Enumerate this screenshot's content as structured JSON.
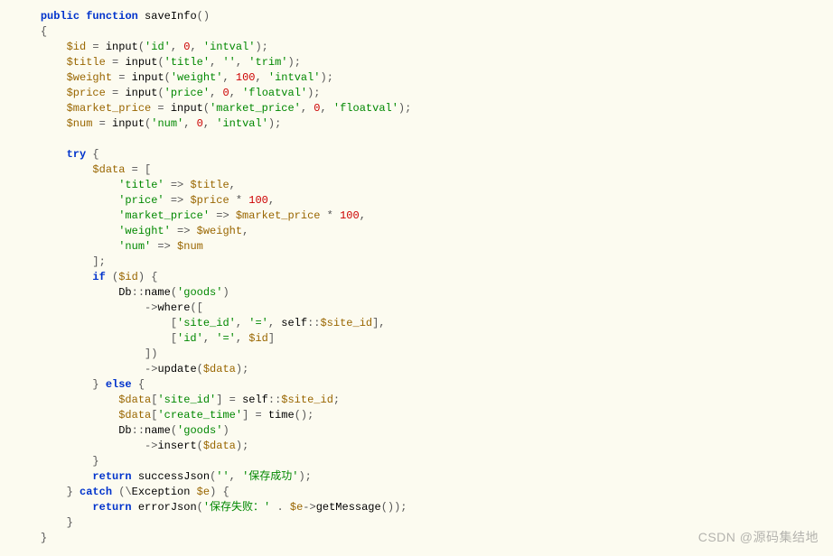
{
  "code": {
    "l1": {
      "kw1": "public",
      "kw2": "function",
      "name": "saveInfo",
      "paren": "()"
    },
    "l2": {
      "brace": "{"
    },
    "l3": {
      "v": "$id",
      "eq": " = ",
      "fn": "input",
      "args_open": "(",
      "s1": "'id'",
      "c1": ", ",
      "n1": "0",
      "c2": ", ",
      "s2": "'intval'",
      "args_close": ");"
    },
    "l4": {
      "v": "$title",
      "eq": " = ",
      "fn": "input",
      "args_open": "(",
      "s1": "'title'",
      "c1": ", ",
      "s2": "''",
      "c2": ", ",
      "s3": "'trim'",
      "args_close": ");"
    },
    "l5": {
      "v": "$weight",
      "eq": " = ",
      "fn": "input",
      "args_open": "(",
      "s1": "'weight'",
      "c1": ", ",
      "n1": "100",
      "c2": ", ",
      "s2": "'intval'",
      "args_close": ");"
    },
    "l6": {
      "v": "$price",
      "eq": " = ",
      "fn": "input",
      "args_open": "(",
      "s1": "'price'",
      "c1": ", ",
      "n1": "0",
      "c2": ", ",
      "s2": "'floatval'",
      "args_close": ");"
    },
    "l7": {
      "v": "$market_price",
      "eq": " = ",
      "fn": "input",
      "args_open": "(",
      "s1": "'market_price'",
      "c1": ", ",
      "n1": "0",
      "c2": ", ",
      "s2": "'floatval'",
      "args_close": ");"
    },
    "l8": {
      "v": "$num",
      "eq": " = ",
      "fn": "input",
      "args_open": "(",
      "s1": "'num'",
      "c1": ", ",
      "n1": "0",
      "c2": ", ",
      "s2": "'intval'",
      "args_close": ");"
    },
    "l10": {
      "kw": "try",
      "brace": " {"
    },
    "l11": {
      "v": "$data",
      "eq": " = ["
    },
    "l12": {
      "s": "'title'",
      "arrow": " => ",
      "v": "$title",
      "comma": ","
    },
    "l13": {
      "s": "'price'",
      "arrow": " => ",
      "v": "$price",
      "tail": " * ",
      "n": "100",
      "comma": ","
    },
    "l14": {
      "s": "'market_price'",
      "arrow": " => ",
      "v": "$market_price",
      "tail": " * ",
      "n": "100",
      "comma": ","
    },
    "l15": {
      "s": "'weight'",
      "arrow": " => ",
      "v": "$weight",
      "comma": ","
    },
    "l16": {
      "s": "'num'",
      "arrow": " => ",
      "v": "$num"
    },
    "l17": {
      "close": "];"
    },
    "l18": {
      "kw": "if",
      "open": " (",
      "v": "$id",
      "close": ") {"
    },
    "l19": {
      "cls": "Db",
      "op": "::",
      "fn": "name",
      "args_open": "(",
      "s": "'goods'",
      "args_close": ")"
    },
    "l20": {
      "arrow": "->",
      "fn": "where",
      "args": "(["
    },
    "l21": {
      "open": "[",
      "s1": "'site_id'",
      "c1": ", ",
      "s2": "'='",
      "c2": ", ",
      "cls": "self",
      "op": "::",
      "mem": "$site_id",
      "close": "],"
    },
    "l22": {
      "open": "[",
      "s1": "'id'",
      "c1": ", ",
      "s2": "'='",
      "c2": ", ",
      "v": "$id",
      "close": "]"
    },
    "l23": {
      "close": "])"
    },
    "l24": {
      "arrow": "->",
      "fn": "update",
      "args_open": "(",
      "v": "$data",
      "args_close": ");"
    },
    "l25": {
      "close": "} ",
      "kw": "else",
      "brace": " {"
    },
    "l26": {
      "v": "$data",
      "idx_open": "[",
      "s": "'site_id'",
      "idx_close": "]",
      " eq": " = ",
      "cls": "self",
      "op": "::",
      "mem": "$site_id",
      "semi": ";"
    },
    "l27": {
      "v": "$data",
      "idx_open": "[",
      "s": "'create_time'",
      "idx_close": "]",
      " eq": " = ",
      "fn": "time",
      "args": "();"
    },
    "l28": {
      "cls": "Db",
      "op": "::",
      "fn": "name",
      "args_open": "(",
      "s": "'goods'",
      "args_close": ")"
    },
    "l29": {
      "arrow": "->",
      "fn": "insert",
      "args_open": "(",
      "v": "$data",
      "args_close": ");"
    },
    "l30": {
      "brace": "}"
    },
    "l31": {
      "kw": "return",
      "sp": " ",
      "fn": "successJson",
      "args_open": "(",
      "s1": "''",
      "c": ", ",
      "s2": "'保存成功'",
      "args_close": ");"
    },
    "l32": {
      "close": "} ",
      "kw": "catch",
      "sp": " (",
      "bs": "\\",
      "cls": "Exception",
      "sp2": " ",
      "v": "$e",
      "close2": ") {"
    },
    "l33": {
      "kw": "return",
      "sp": " ",
      "fn": "errorJson",
      "args_open": "(",
      "s": "'保存失败：'",
      "tail": " . ",
      "v": "$e",
      "arrow": "->",
      "fn2": "getMessage",
      "args2": "());"
    },
    "l34": {
      "brace": "}"
    },
    "l35": {
      "brace": "}"
    }
  },
  "watermark": "CSDN @源码集结地"
}
